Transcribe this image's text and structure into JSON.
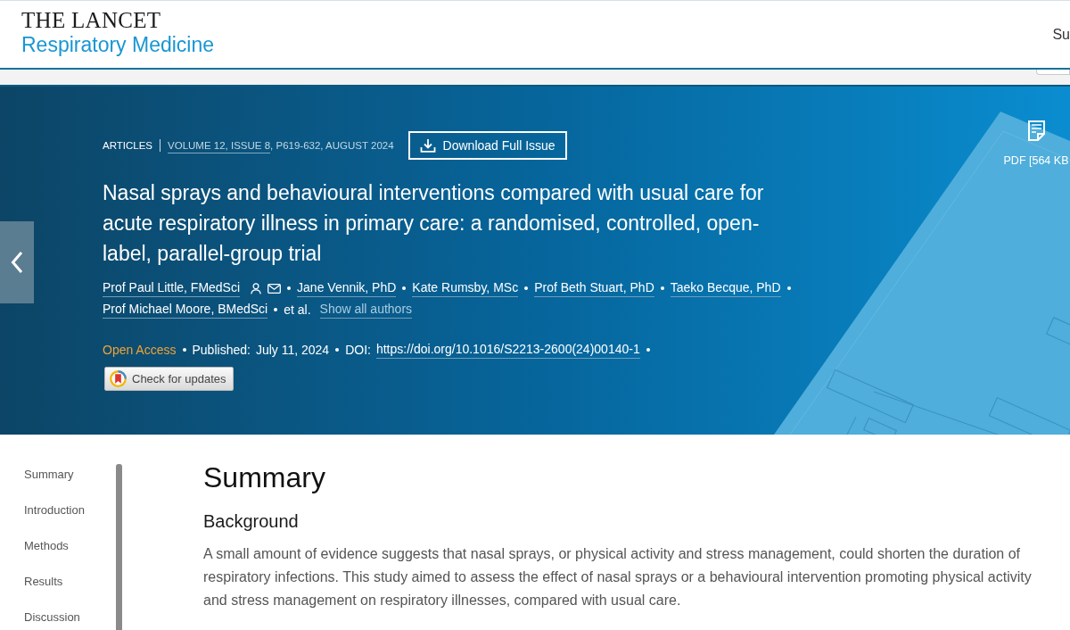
{
  "header": {
    "logo_title": "THE LANCET",
    "logo_subtitle": "Respiratory Medicine",
    "nav_link": "Su"
  },
  "article": {
    "section": "ARTICLES",
    "issue_link": "VOLUME 12, ISSUE 8",
    "issue_details": ", P619-632, AUGUST 2024",
    "download_button": "Download Full Issue",
    "title": "Nasal sprays and behavioural interventions compared with usual care for acute respiratory illness in primary care: a randomised, controlled, open-label, parallel-group trial",
    "authors": [
      {
        "name": "Prof Paul Little, FMedSci",
        "corresponding": true
      },
      {
        "name": "Jane Vennik, PhD",
        "corresponding": false
      },
      {
        "name": "Kate Rumsby, MSc",
        "corresponding": false
      },
      {
        "name": "Prof Beth Stuart, PhD",
        "corresponding": false
      },
      {
        "name": "Taeko Becque, PhD",
        "corresponding": false
      },
      {
        "name": "Prof Michael Moore, BMedSci",
        "corresponding": false
      }
    ],
    "et_al": "et al.",
    "show_all_authors": "Show all authors",
    "access": "Open Access",
    "published_label": "Published:",
    "published_date": "July 11, 2024",
    "doi_label": "DOI:",
    "doi": "https://doi.org/10.1016/S2213-2600(24)00140-1",
    "check_updates_button": "Check for updates"
  },
  "pdf_link": {
    "label": "PDF [564 KB"
  },
  "section_nav": {
    "items": [
      {
        "label": "Summary"
      },
      {
        "label": "Introduction"
      },
      {
        "label": "Methods"
      },
      {
        "label": "Results"
      },
      {
        "label": "Discussion"
      }
    ]
  },
  "summary": {
    "heading": "Summary",
    "subheading": "Background",
    "paragraph": "A small amount of evidence suggests that nasal sprays, or physical activity and stress management, could shorten the duration of respiratory infections. This study aimed to assess the effect of nasal sprays or a behavioural intervention promoting physical activity and stress management on respiratory illnesses, compared with usual care."
  }
}
